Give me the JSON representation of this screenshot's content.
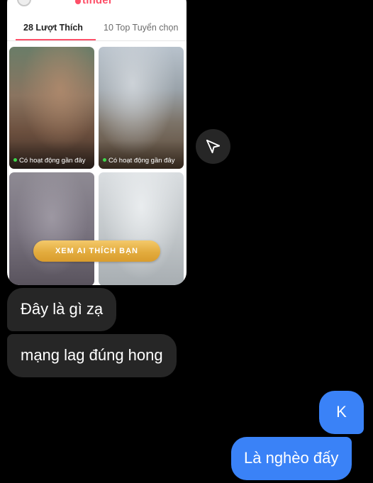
{
  "shared_screenshot": {
    "app_logo_text": "tinder",
    "tabs": [
      {
        "label": "28 Lượt Thích"
      },
      {
        "label": "10 Top Tuyển chọn"
      }
    ],
    "tiles": [
      {
        "status": "Có hoạt động gần đây"
      },
      {
        "status": "Có hoạt động gần đây"
      },
      {
        "status": ""
      },
      {
        "status": ""
      }
    ],
    "cta_label": "XEM AI THÍCH BẠN",
    "accent_color": "#fd4f68",
    "cta_color": "#e3ac3e"
  },
  "share_button": {
    "icon": "paper-plane-icon"
  },
  "messages": [
    {
      "side": "incoming",
      "text": "Đây là gì zạ"
    },
    {
      "side": "incoming",
      "text": "mạng lag đúng hong"
    },
    {
      "side": "outgoing",
      "text": "K"
    },
    {
      "side": "outgoing",
      "text": "Là nghèo đấy"
    }
  ],
  "colors": {
    "background": "#000000",
    "incoming_bubble": "#262626",
    "outgoing_bubble": "#3a82f7"
  }
}
